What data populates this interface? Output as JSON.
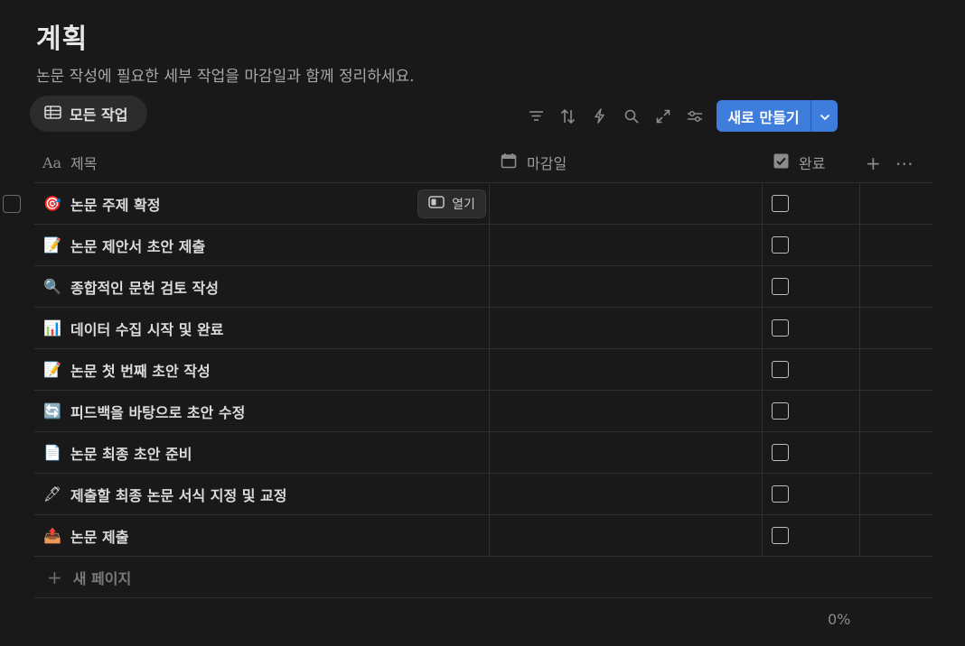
{
  "page": {
    "title": "계획",
    "description": "논문 작성에 필요한 세부 작업을 마감일과 함께 정리하세요."
  },
  "view_tab": {
    "label": "모든 작업",
    "icon": "table-icon"
  },
  "toolbar": {
    "icons": [
      "filter-icon",
      "sort-icon",
      "lightning-icon",
      "search-icon",
      "expand-icon",
      "settings-sliders-icon"
    ],
    "new_button_label": "새로 만들기",
    "accent_color": "#3f7ddc"
  },
  "table": {
    "columns": [
      {
        "label": "제목",
        "icon": "Aa"
      },
      {
        "label": "마감일",
        "icon": "calendar-icon"
      },
      {
        "label": "완료",
        "icon": "checkbox-icon"
      }
    ],
    "rows": [
      {
        "icon": "🎯",
        "title": "논문 주제 확정",
        "done": false
      },
      {
        "icon": "📝",
        "title": "논문 제안서 초안 제출",
        "done": false
      },
      {
        "icon": "🔍",
        "title": "종합적인 문헌 검토 작성",
        "done": false
      },
      {
        "icon": "📊",
        "title": "데이터 수집 시작 및 완료",
        "done": false
      },
      {
        "icon": "📝",
        "title": "논문 첫 번째 초안 작성",
        "done": false
      },
      {
        "icon": "🔄",
        "title": "피드백을 바탕으로 초안 수정",
        "done": false
      },
      {
        "icon": "📄",
        "title": "논문 최종 초안 준비",
        "done": false
      },
      {
        "icon": "🖋",
        "title": "제출할 최종 논문 서식 지정 및 교정",
        "done": false
      },
      {
        "icon": "📤",
        "title": "논문 제출",
        "done": false
      }
    ],
    "open_button_label": "열기",
    "new_page_label": "새 페이지",
    "completion_summary": "0%"
  }
}
